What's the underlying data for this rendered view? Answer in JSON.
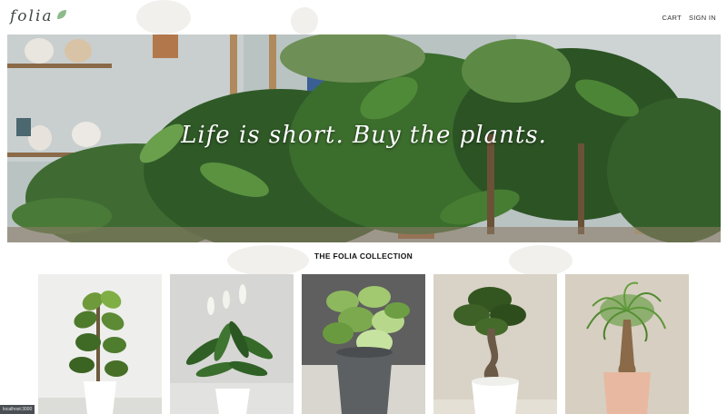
{
  "brand": {
    "name": "folia",
    "accent": "#8dbb8a"
  },
  "nav": {
    "cart": "CART",
    "sign_in": "SIGN IN"
  },
  "hero": {
    "tagline": "Life is short. Buy the plants."
  },
  "collection": {
    "title": "THE FOLIA COLLECTION",
    "products": [
      {
        "icon": "fiddle-leaf-fig-icon"
      },
      {
        "icon": "peace-lily-icon"
      },
      {
        "icon": "pothos-icon"
      },
      {
        "icon": "bonsai-icon"
      },
      {
        "icon": "ponytail-palm-icon"
      }
    ]
  },
  "status_bar": {
    "text": "localhost:3000"
  }
}
